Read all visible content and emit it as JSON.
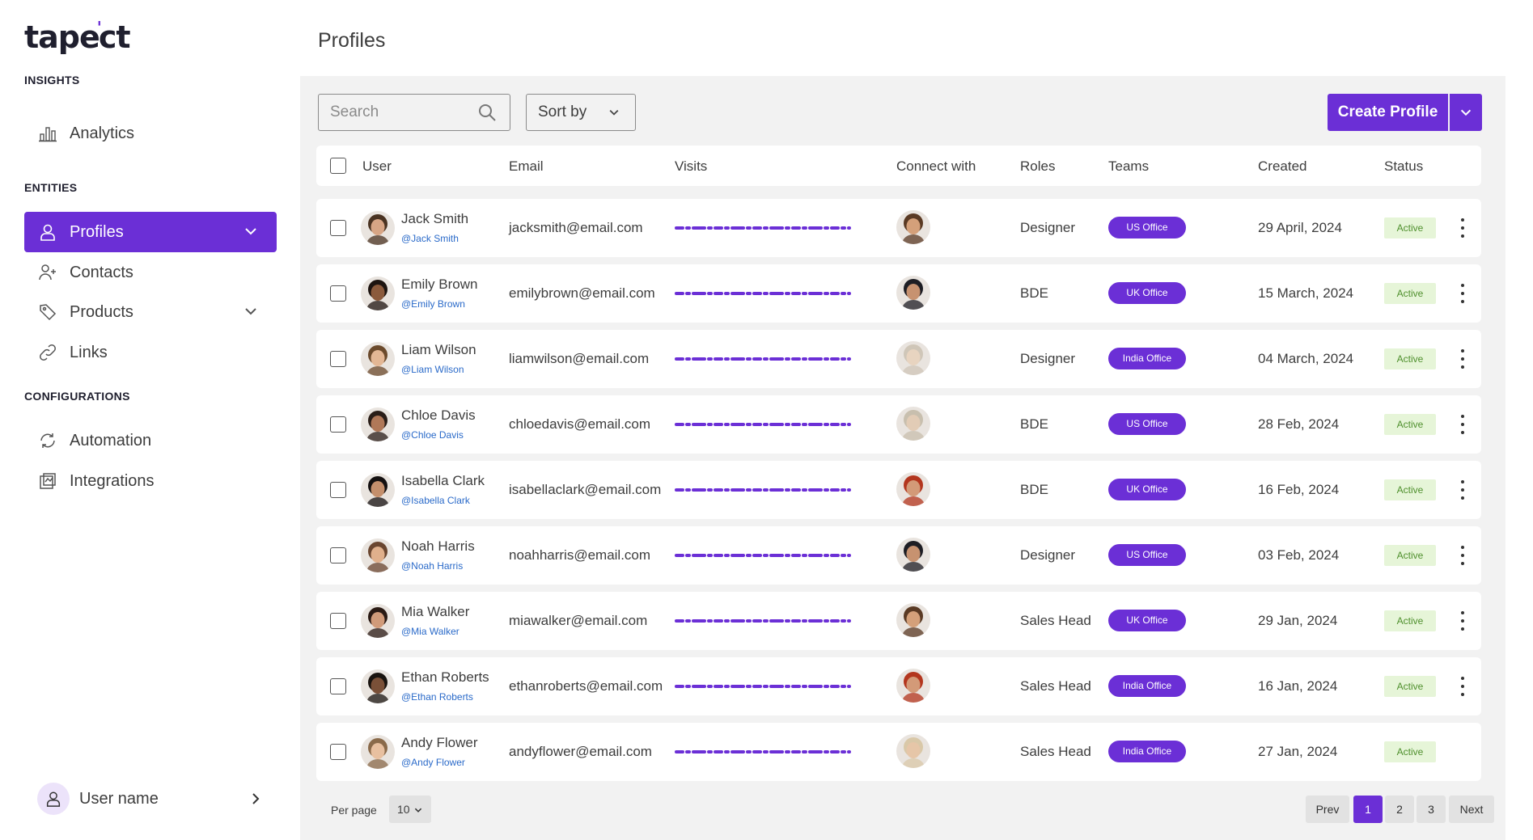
{
  "app": {
    "logo_left": "tape",
    "logo_mark": "'",
    "logo_right": "ct"
  },
  "sidebar": {
    "insights_title": "INSIGHTS",
    "analytics_label": "Analytics",
    "entities_title": "ENTITIES",
    "profiles_label": "Profiles",
    "contacts_label": "Contacts",
    "products_label": "Products",
    "links_label": "Links",
    "configurations_title": "CONFIGURATIONS",
    "automation_label": "Automation",
    "integrations_label": "Integrations",
    "user_name": "User name"
  },
  "page": {
    "title": "Profiles"
  },
  "toolbar": {
    "search_placeholder": "Search",
    "sort_label": "Sort by",
    "create_label": "Create Profile"
  },
  "table": {
    "headers": {
      "user": "User",
      "email": "Email",
      "visits": "Visits",
      "connect": "Connect with",
      "roles": "Roles",
      "teams": "Teams",
      "created": "Created",
      "status": "Status"
    },
    "rows": [
      {
        "name": "Jack Smith",
        "handle": "@Jack Smith",
        "email": "jacksmith@email.com",
        "role": "Designer",
        "team": "US Office",
        "created": "29 April, 2024",
        "status": "Active"
      },
      {
        "name": "Emily Brown",
        "handle": "@Emily Brown",
        "email": "emilybrown@email.com",
        "role": "BDE",
        "team": "UK Office",
        "created": "15 March, 2024",
        "status": "Active"
      },
      {
        "name": "Liam Wilson",
        "handle": "@Liam Wilson",
        "email": "liamwilson@email.com",
        "role": "Designer",
        "team": "India Office",
        "created": "04 March, 2024",
        "status": "Active"
      },
      {
        "name": "Chloe Davis",
        "handle": "@Chloe Davis",
        "email": "chloedavis@email.com",
        "role": "BDE",
        "team": "US Office",
        "created": "28 Feb, 2024",
        "status": "Active"
      },
      {
        "name": "Isabella Clark",
        "handle": "@Isabella Clark",
        "email": "isabellaclark@email.com",
        "role": "BDE",
        "team": "UK Office",
        "created": "16 Feb, 2024",
        "status": "Active"
      },
      {
        "name": "Noah Harris",
        "handle": "@Noah Harris",
        "email": "noahharris@email.com",
        "role": "Designer",
        "team": "US Office",
        "created": "03 Feb, 2024",
        "status": "Active"
      },
      {
        "name": "Mia Walker",
        "handle": "@Mia Walker",
        "email": "miawalker@email.com",
        "role": "Sales Head",
        "team": "UK Office",
        "created": "29 Jan, 2024",
        "status": "Active"
      },
      {
        "name": "Ethan Roberts",
        "handle": "@Ethan Roberts",
        "email": "ethanroberts@email.com",
        "role": "Sales Head",
        "team": "India Office",
        "created": "16 Jan, 2024",
        "status": "Active"
      },
      {
        "name": "Andy Flower",
        "handle": "@Andy Flower",
        "email": "andyflower@email.com",
        "role": "Sales Head",
        "team": "India Office",
        "created": "27 Jan, 2024",
        "status": "Active"
      }
    ]
  },
  "footer": {
    "per_page_label": "Per page",
    "per_page_value": "10",
    "prev": "Prev",
    "pages": [
      "1",
      "2",
      "3"
    ],
    "next": "Next"
  },
  "colors": {
    "accent": "#6b2fd6",
    "status_bg": "#e6f5d8",
    "status_text": "#4e8f2c",
    "panel_bg": "#f2f2f2",
    "link": "#2a6ac9"
  }
}
